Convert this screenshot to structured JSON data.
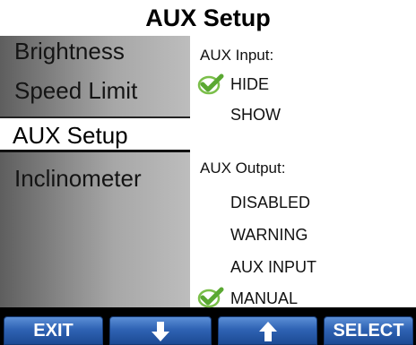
{
  "title": "AUX Setup",
  "menu": {
    "items": [
      {
        "label": "Brightness"
      },
      {
        "label": "Speed Limit"
      },
      {
        "label": "AUX Setup"
      },
      {
        "label": "Inclinometer"
      }
    ],
    "selected_index": 2
  },
  "options": {
    "aux_input": {
      "heading": "AUX Input:",
      "items": [
        "HIDE",
        "SHOW"
      ],
      "checked": "HIDE"
    },
    "aux_output": {
      "heading": "AUX Output:",
      "items": [
        "DISABLED",
        "WARNING",
        "AUX INPUT",
        "MANUAL"
      ],
      "checked": "MANUAL"
    }
  },
  "softkeys": {
    "exit": "EXIT",
    "down_icon": "arrow-down-icon",
    "up_icon": "arrow-up-icon",
    "select": "SELECT"
  },
  "colors": {
    "check": "#7bbf4a",
    "softkey": "#2f63b4",
    "selected_row": "#ffffff"
  }
}
